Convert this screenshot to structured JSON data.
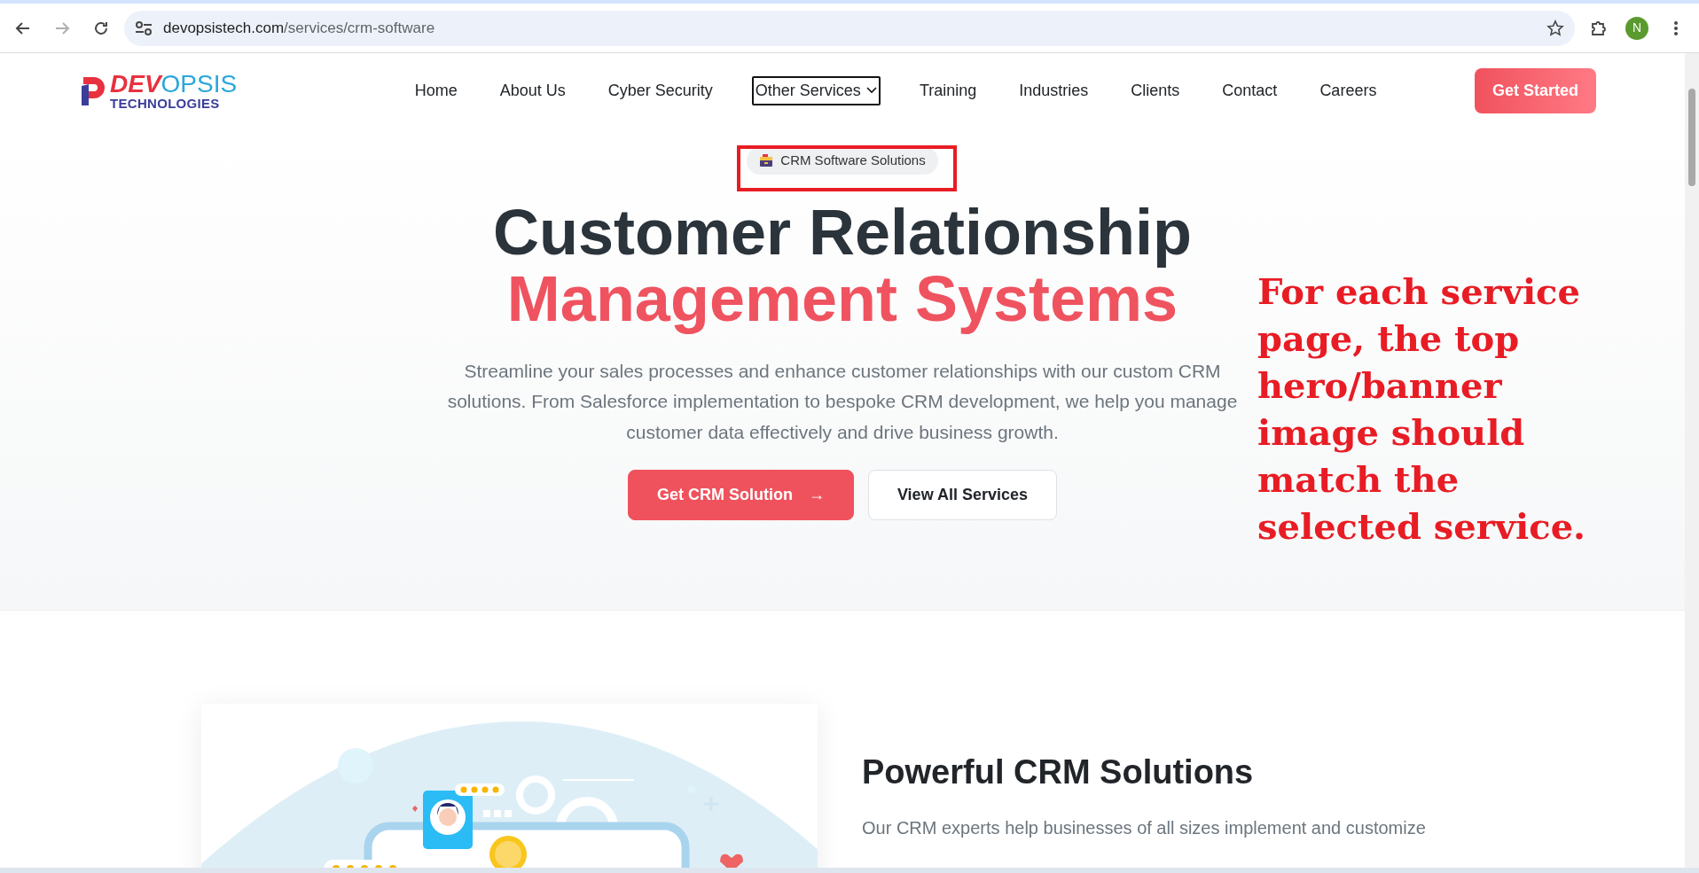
{
  "browser": {
    "url_host": "devopsistech.com",
    "url_path": "/services/crm-software",
    "back_disabled": false,
    "forward_disabled": true,
    "profile_initial": "N"
  },
  "site": {
    "logo": {
      "part_1": "DEV",
      "part_2": "OPSIS",
      "part_3": "TECHNOLOGIES"
    },
    "nav": [
      {
        "label": "Home",
        "kind": "link",
        "focused": false
      },
      {
        "label": "About Us",
        "kind": "link",
        "focused": false
      },
      {
        "label": "Cyber Security",
        "kind": "link",
        "focused": false
      },
      {
        "label": "Other Services",
        "kind": "dropdown",
        "focused": true
      },
      {
        "label": "Training",
        "kind": "link",
        "focused": false
      },
      {
        "label": "Industries",
        "kind": "link",
        "focused": false
      },
      {
        "label": "Clients",
        "kind": "link",
        "focused": false
      },
      {
        "label": "Contact",
        "kind": "link",
        "focused": false
      },
      {
        "label": "Careers",
        "kind": "link",
        "focused": false
      }
    ],
    "cta": "Get Started"
  },
  "hero": {
    "badge": "CRM Software Solutions",
    "title_line_1": "Customer Relationship",
    "title_line_2": "Management Systems",
    "description": "Streamline your sales processes and enhance customer relationships with our custom CRM solutions. From Salesforce implementation to bespoke CRM development, we help you manage customer data effectively and drive business growth.",
    "buttons": [
      {
        "label": "Get CRM Solution",
        "kind": "primary",
        "arrow": "→"
      },
      {
        "label": "View All Services",
        "kind": "outline"
      }
    ]
  },
  "section": {
    "heading": "Powerful CRM Solutions",
    "text": "Our CRM experts help businesses of all sizes implement and customize"
  },
  "annotation": {
    "lines": [
      "For each service",
      "page, the top",
      "hero/banner",
      "image should",
      "match the",
      "selected service."
    ]
  }
}
